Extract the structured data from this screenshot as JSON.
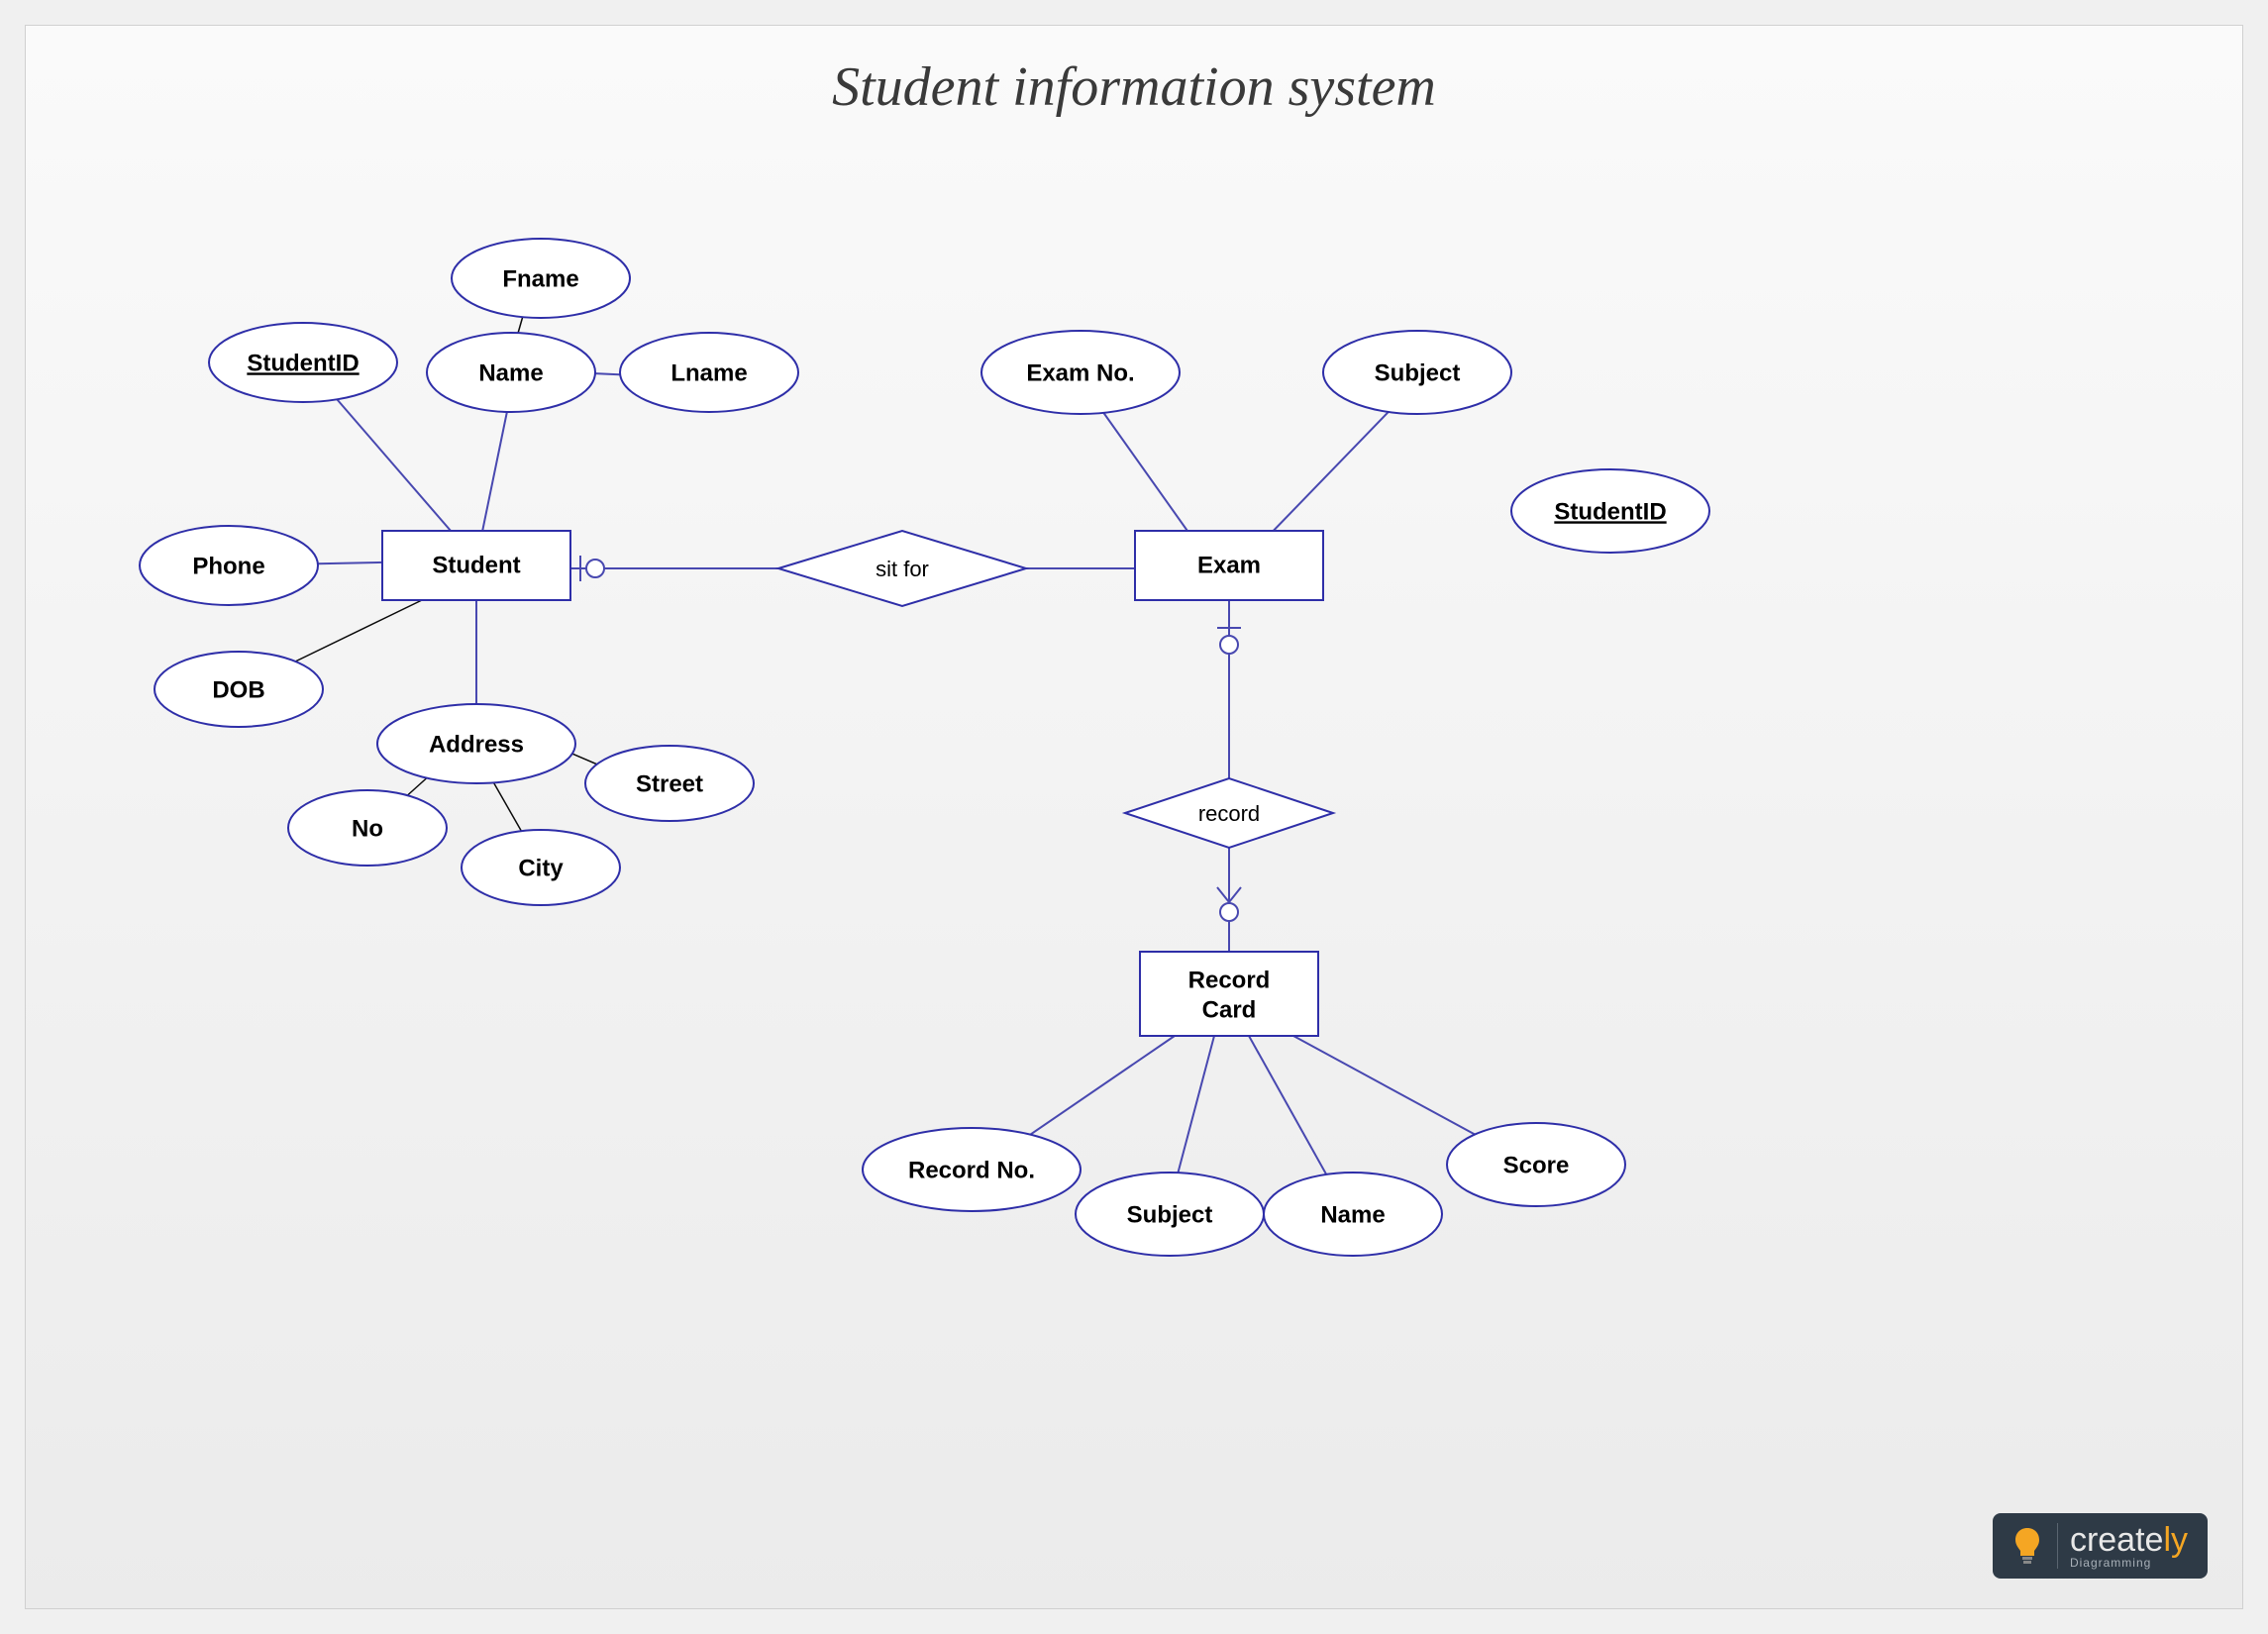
{
  "title": "Student information system",
  "entities": {
    "student": "Student",
    "exam": "Exam",
    "record_card_l1": "Record",
    "record_card_l2": "Card"
  },
  "relationships": {
    "sit_for": "sit for",
    "record": "record"
  },
  "attributes": {
    "student": {
      "student_id": "StudentID",
      "fname": "Fname",
      "lname": "Lname",
      "name": "Name",
      "phone": "Phone",
      "dob": "DOB",
      "address": "Address",
      "no": "No",
      "city": "City",
      "street": "Street"
    },
    "exam": {
      "exam_no": "Exam No.",
      "subject": "Subject",
      "student_id": "StudentID"
    },
    "record_card": {
      "record_no": "Record No.",
      "subject": "Subject",
      "name": "Name",
      "score": "Score"
    }
  },
  "logo": {
    "main_left": "create",
    "main_right": "ly",
    "sub": "Diagramming"
  }
}
